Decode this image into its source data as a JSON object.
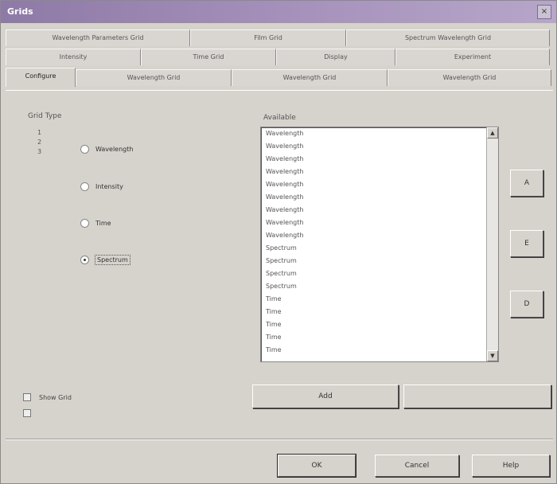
{
  "window": {
    "title": "Grids",
    "close_glyph": "×"
  },
  "tabs": {
    "row1": [
      "Wavelength Parameters Grid",
      "Film Grid",
      "Spectrum Wavelength Grid"
    ],
    "row2": [
      "Intensity",
      "Time Grid",
      "Display",
      "Experiment"
    ],
    "row3": [
      "Configure",
      "Wavelength Grid",
      "Wavelength Grid",
      "Wavelength Grid"
    ],
    "active": "Configure"
  },
  "grid_type": {
    "label": "Grid Type",
    "side_marks": [
      "1",
      "2",
      "3"
    ],
    "options": [
      "Wavelength",
      "Intensity",
      "Time",
      "Spectrum"
    ],
    "selected_index": 3
  },
  "available": {
    "label": "Available",
    "items": [
      "Wavelength",
      "Wavelength",
      "Wavelength",
      "Wavelength",
      "Wavelength",
      "Wavelength",
      "Wavelength",
      "Wavelength",
      "Wavelength",
      "Spectrum",
      "Spectrum",
      "Spectrum",
      "Spectrum",
      "Time",
      "Time",
      "Time",
      "Time",
      "Time",
      "Time",
      "Time"
    ]
  },
  "side_buttons": {
    "add": "A",
    "edit": "E",
    "delete": "D"
  },
  "bottom": {
    "show_grid_label": "Show Grid",
    "add_button": "Add",
    "disabled_button": ""
  },
  "footer": {
    "ok": "OK",
    "cancel": "Cancel",
    "help": "Help"
  }
}
